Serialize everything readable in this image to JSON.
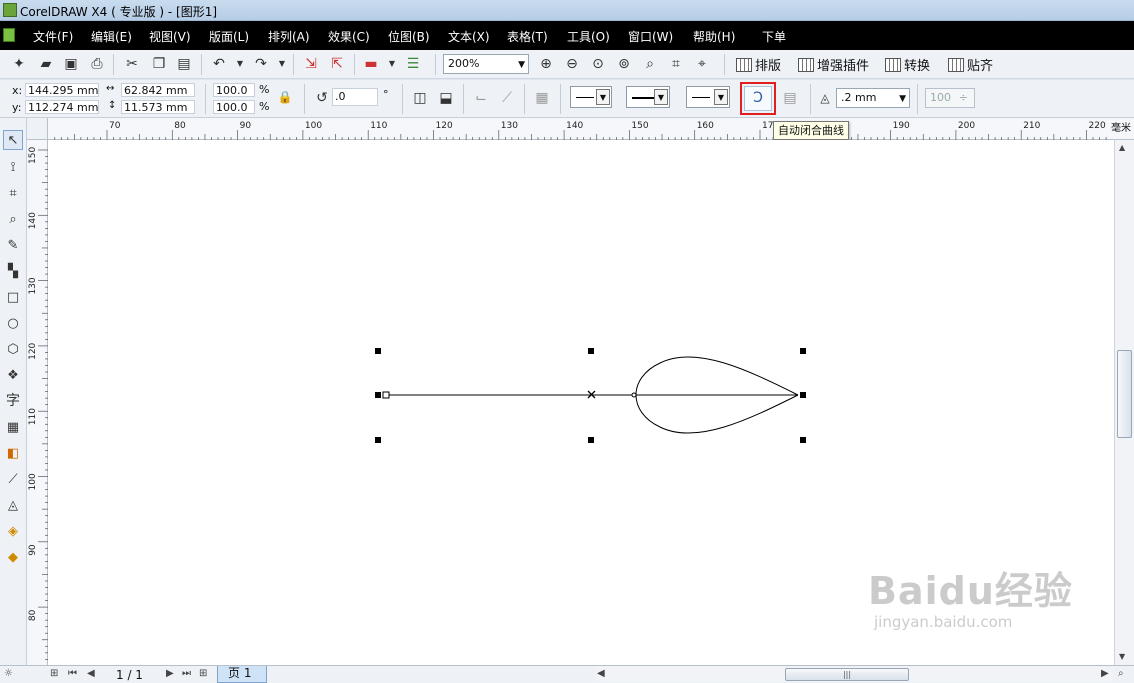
{
  "window": {
    "title": "CorelDRAW X4 ( 专业版 ) - [图形1]"
  },
  "menu": {
    "items": [
      "文件(F)",
      "编辑(E)",
      "视图(V)",
      "版面(L)",
      "排列(A)",
      "效果(C)",
      "位图(B)",
      "文本(X)",
      "表格(T)",
      "工具(O)",
      "窗口(W)",
      "帮助(H)",
      "下单"
    ]
  },
  "toolbar": {
    "zoom": "200%",
    "plugins": [
      "排版",
      "增强插件",
      "转换",
      "贴齐"
    ]
  },
  "property_bar": {
    "x_label": "x:",
    "x_value": "144.295 mm",
    "y_label": "y:",
    "y_value": "112.274 mm",
    "width_value": "62.842 mm",
    "height_value": "11.573 mm",
    "scale_x": "100.0",
    "scale_y": "100.0",
    "percent": "%",
    "rotation": ".0",
    "degree": "°",
    "outline_width": ".2 mm",
    "smoothness": "100"
  },
  "tooltip": {
    "text": "自动闭合曲线"
  },
  "ruler": {
    "h_ticks": [
      "70",
      "80",
      "90",
      "100",
      "110",
      "120",
      "130",
      "140",
      "150",
      "160",
      "170",
      "180",
      "190",
      "200",
      "210",
      "220"
    ],
    "h_unit": "毫米",
    "v_ticks": [
      "150",
      "140",
      "130",
      "120",
      "110",
      "100",
      "90",
      "80"
    ],
    "corner_units": "毫米"
  },
  "status": {
    "page_count": "1 / 1",
    "page_tab": "页 1"
  },
  "watermark": {
    "logo": "Baidu经验",
    "url": "jingyan.baidu.com"
  },
  "colors": {
    "menubar_bg": "#000000",
    "highlight": "#e02020",
    "selection_handle": "#000000"
  }
}
